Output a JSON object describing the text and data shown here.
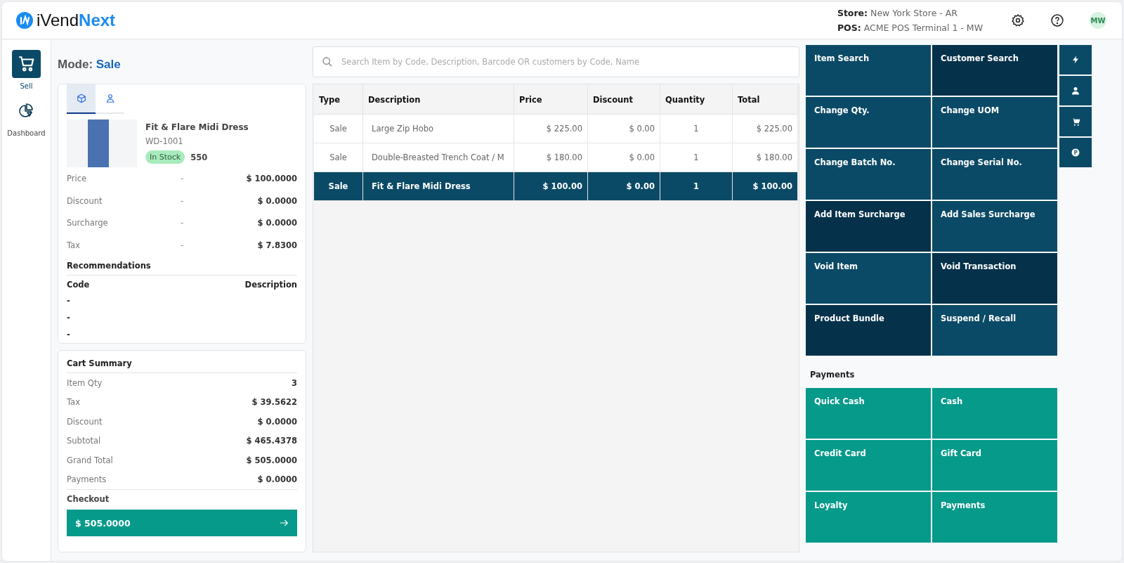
{
  "app": {
    "logo_prefix": "iVend",
    "logo_suffix": "Next"
  },
  "header": {
    "store_label": "Store:",
    "store": "New York Store - AR",
    "pos_label": "POS:",
    "pos": "ACME POS Terminal 1 - MW",
    "avatar": "MW"
  },
  "nav": [
    {
      "label": "Sell",
      "kind": "cart",
      "selected": true
    },
    {
      "label": "Dashboard",
      "kind": "chart",
      "selected": false
    }
  ],
  "mode": {
    "label": "Mode:",
    "value": "Sale"
  },
  "item_panel": {
    "tabs": [
      {
        "kind": "product",
        "selected": true
      },
      {
        "kind": "customer",
        "selected": false
      }
    ],
    "name": "Fit & Flare Midi Dress",
    "code": "WD-1001",
    "stock_badge": "In Stock",
    "stock_qty": "550",
    "rows": [
      {
        "label": "Price",
        "separator": "-",
        "value": "$ 100.0000"
      },
      {
        "label": "Discount",
        "separator": "-",
        "value": "$ 0.0000"
      },
      {
        "label": "Surcharge",
        "separator": "-",
        "value": "$ 0.0000"
      },
      {
        "label": "Tax",
        "separator": "-",
        "value": "$ 7.8300"
      }
    ],
    "recommendations": {
      "title": "Recommendations",
      "columns": [
        "Code",
        "Description"
      ],
      "rows": [
        "-",
        "-",
        "-"
      ]
    }
  },
  "cart_summary": {
    "title": "Cart Summary",
    "rows": [
      {
        "label": "Item Qty",
        "value": "3"
      },
      {
        "label": "Tax",
        "value": "$ 39.5622"
      },
      {
        "label": "Discount",
        "value": "$ 0.0000"
      },
      {
        "label": "Subtotal",
        "value": "$ 465.4378"
      },
      {
        "label": "Grand Total",
        "value": "$ 505.0000"
      },
      {
        "label": "Payments",
        "value": "$ 0.0000"
      }
    ],
    "checkout_label": "Checkout",
    "checkout_amount": "$ 505.0000"
  },
  "search": {
    "placeholder": "Search Item by Code, Description, Barcode OR customers by Code, Name"
  },
  "table": {
    "columns": [
      "Type",
      "Description",
      "Price",
      "Discount",
      "Quantity",
      "Total"
    ],
    "rows": [
      {
        "cells": [
          "Sale",
          "Large Zip Hobo",
          "$ 225.00",
          "$ 0.00",
          "1",
          "$ 225.00"
        ],
        "selected": false
      },
      {
        "cells": [
          "Sale",
          "Double-Breasted Trench Coat / M",
          "$ 180.00",
          "$ 0.00",
          "1",
          "$ 180.00"
        ],
        "selected": false
      },
      {
        "cells": [
          "Sale",
          "Fit & Flare Midi Dress",
          "$ 100.00",
          "$ 0.00",
          "1",
          "$ 100.00"
        ],
        "selected": true
      }
    ]
  },
  "actions": [
    {
      "label": "Item Search",
      "color": "#0b4a66"
    },
    {
      "label": "Customer Search",
      "color": "#05324a"
    },
    {
      "label": "Change Qty.",
      "color": "#0b4a66"
    },
    {
      "label": "Change UOM",
      "color": "#0b4a66"
    },
    {
      "label": "Change Batch No.",
      "color": "#0b4a66"
    },
    {
      "label": "Change Serial No.",
      "color": "#0b4a66"
    },
    {
      "label": "Add Item Surcharge",
      "color": "#05324a"
    },
    {
      "label": "Add Sales Surcharge",
      "color": "#0b4a66"
    },
    {
      "label": "Void Item",
      "color": "#0b4a66"
    },
    {
      "label": "Void Transaction",
      "color": "#05324a"
    },
    {
      "label": "Product Bundle",
      "color": "#05324a"
    },
    {
      "label": "Suspend / Recall",
      "color": "#0b4a66"
    }
  ],
  "quick_icons": [
    {
      "kind": "bolt"
    },
    {
      "kind": "user"
    },
    {
      "kind": "cart"
    },
    {
      "kind": "coin"
    }
  ],
  "payments": {
    "title": "Payments",
    "buttons": [
      "Quick Cash",
      "Cash",
      "Credit Card",
      "Gift Card",
      "Loyalty",
      "Payments"
    ]
  }
}
